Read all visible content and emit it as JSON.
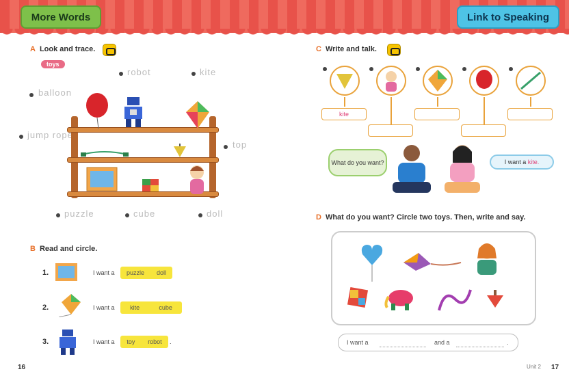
{
  "header": {
    "left_tab": "More Words",
    "right_tab": "Link to Speaking"
  },
  "sectionA": {
    "letter": "A",
    "instruction": "Look and trace.",
    "pill": "toys",
    "words": {
      "robot": "robot",
      "kite": "kite",
      "balloon": "balloon",
      "jump_rope": "jump rope",
      "top": "top",
      "puzzle": "puzzle",
      "cube": "cube",
      "doll": "doll"
    }
  },
  "sectionB": {
    "letter": "B",
    "instruction": "Read and circle.",
    "items": [
      {
        "num": "1.",
        "text": "I want a",
        "opt1": "puzzle",
        "opt2": "doll",
        "end": "."
      },
      {
        "num": "2.",
        "text": "I want a",
        "opt1": "kite",
        "opt2": "cube",
        "end": "."
      },
      {
        "num": "3.",
        "text": "I want a",
        "opt1": "toy",
        "opt2": "robot",
        "end": "."
      }
    ]
  },
  "sectionC": {
    "letter": "C",
    "instruction": "Write and talk.",
    "first_answer": "kite",
    "boy_bubble": "What do you want?",
    "girl_bubble": "I want a",
    "girl_bubble_word": "kite."
  },
  "sectionD": {
    "letter": "D",
    "instruction": "What do you want? Circle two toys. Then, write and say.",
    "line_start": "I want a",
    "line_mid": "and a",
    "line_end": "."
  },
  "pages": {
    "left": "16",
    "right": "17",
    "right_small": "Unit 2"
  }
}
